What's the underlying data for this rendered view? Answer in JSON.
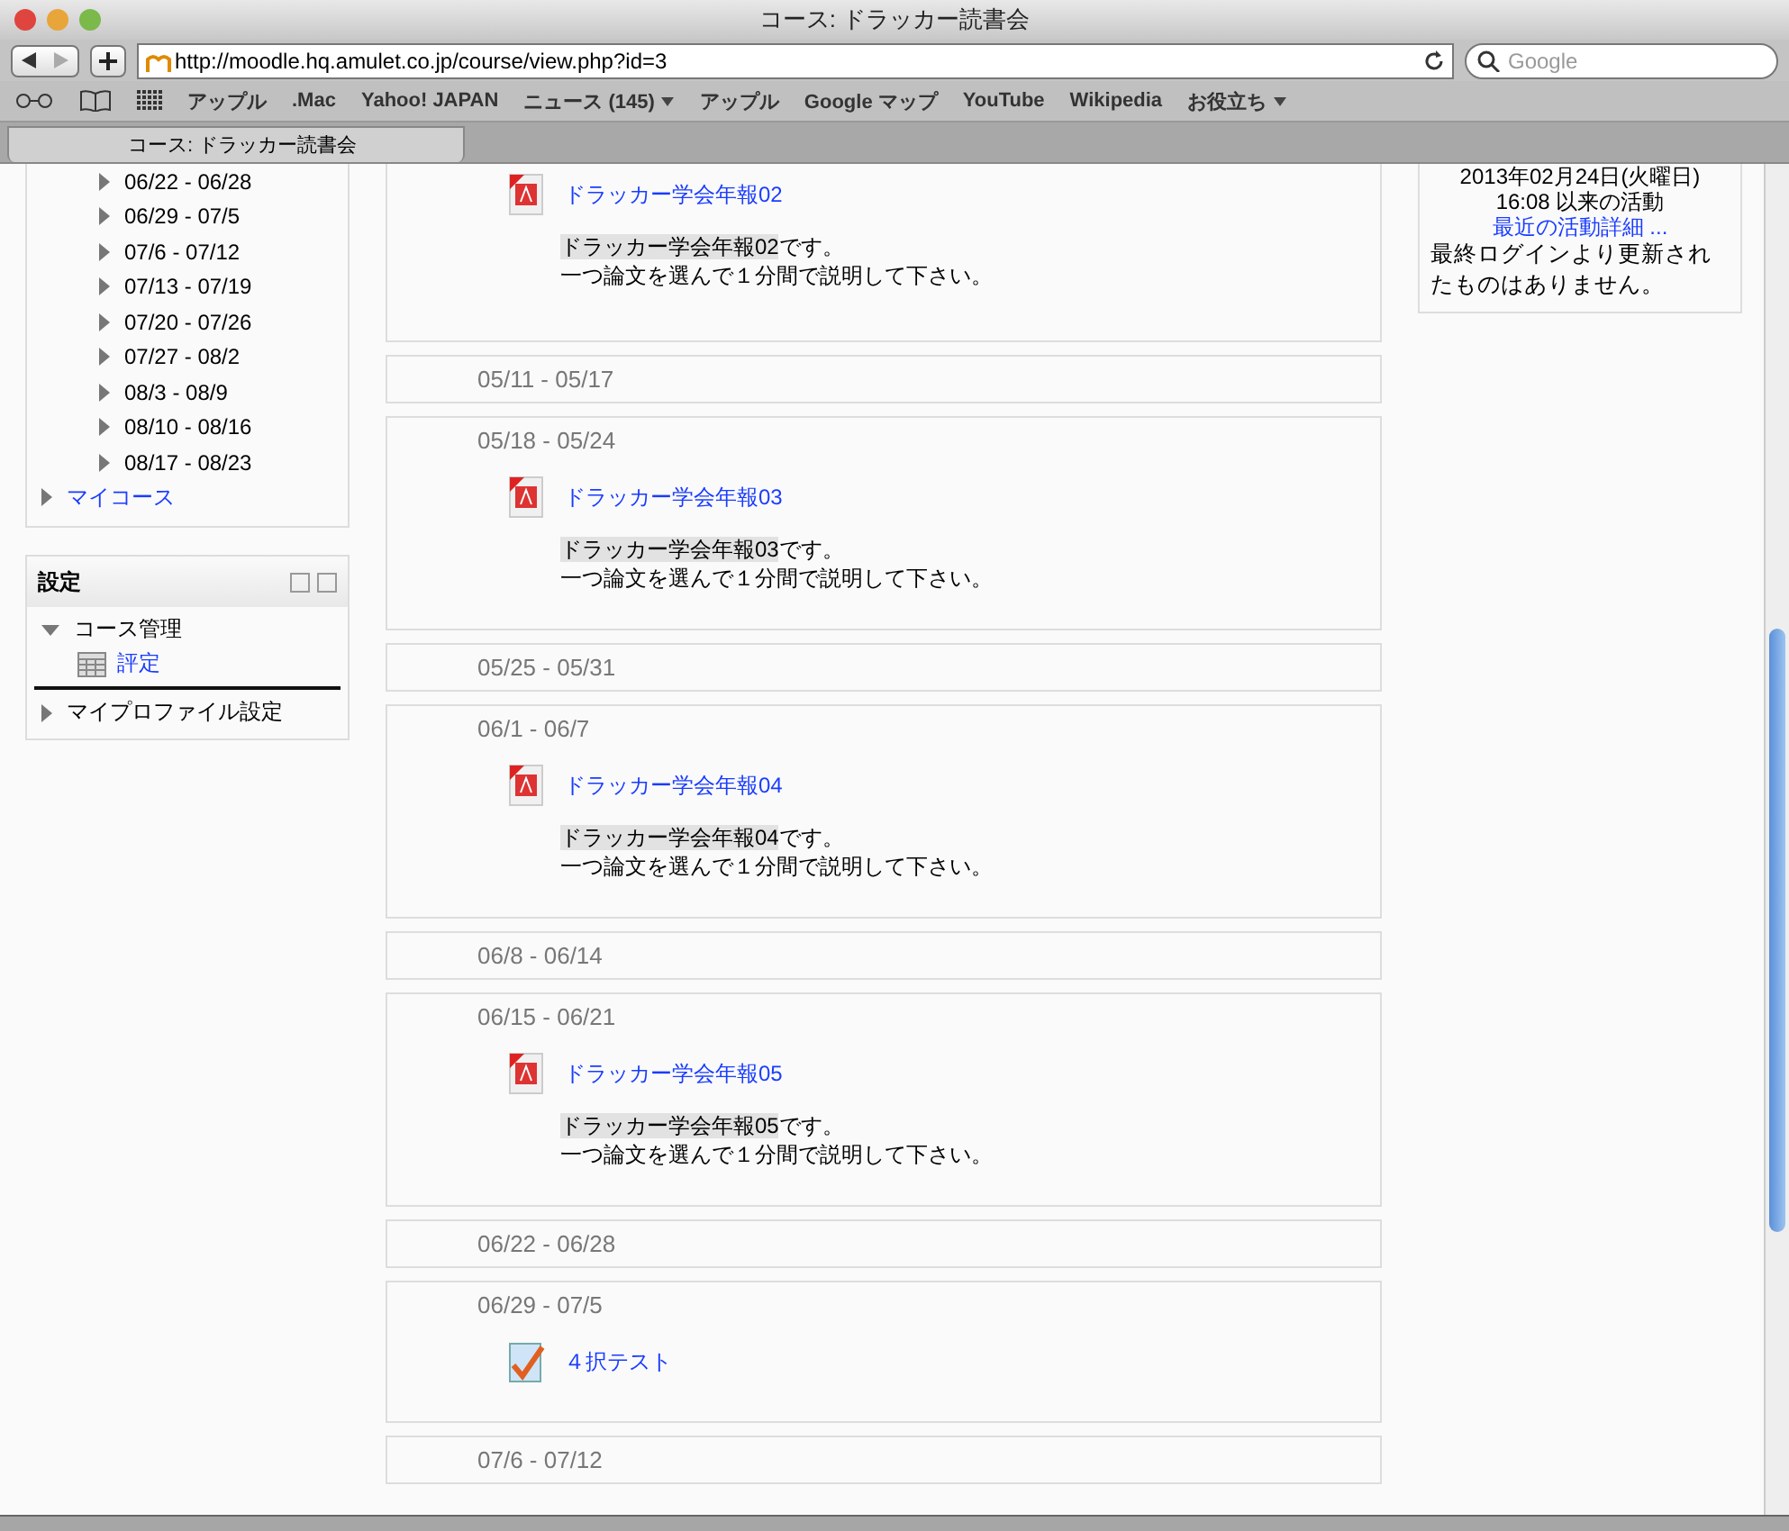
{
  "window": {
    "title": "コース: ドラッカー読書会"
  },
  "toolbar": {
    "url": "http://moodle.hq.amulet.co.jp/course/view.php?id=3",
    "search": {
      "placeholder": "Google"
    }
  },
  "bookmarks": [
    {
      "label": "アップル",
      "menu": false
    },
    {
      "label": ".Mac",
      "menu": false
    },
    {
      "label": "Yahoo! JAPAN",
      "menu": false
    },
    {
      "label": "ニュース (145)",
      "menu": true
    },
    {
      "label": "アップル",
      "menu": false
    },
    {
      "label": "Google マップ",
      "menu": false
    },
    {
      "label": "YouTube",
      "menu": false
    },
    {
      "label": "Wikipedia",
      "menu": false
    },
    {
      "label": "お役立ち",
      "menu": true
    }
  ],
  "tabs": [
    {
      "label": "コース: ドラッカー読書会",
      "selected": true
    }
  ],
  "navigation": {
    "weeks": [
      "06/22 - 06/28",
      "06/29 - 07/5",
      "07/6 - 07/12",
      "07/13 - 07/19",
      "07/20 - 07/26",
      "07/27 - 08/2",
      "08/3 - 08/9",
      "08/10 - 08/16",
      "08/17 - 08/23"
    ],
    "my_courses": "マイコース"
  },
  "settings": {
    "title": "設定",
    "items": [
      {
        "label": "コース管理",
        "expanded": true,
        "children": [
          {
            "label": "評定"
          }
        ]
      },
      {
        "label": "マイプロファイル設定",
        "expanded": false
      }
    ]
  },
  "sections": [
    {
      "activities": [
        {
          "kind": "pdf",
          "link": "ドラッカー学会年報02",
          "highlight": "ドラッカー学会年報02",
          "rest": "です。",
          "note": "一つ論文を選んで１分間で説明して下さい。"
        }
      ]
    },
    {
      "title": "05/11 - 05/17"
    },
    {
      "title": "05/18 - 05/24",
      "activities": [
        {
          "kind": "pdf",
          "link": "ドラッカー学会年報03",
          "highlight": "ドラッカー学会年報03",
          "rest": "です。",
          "note": "一つ論文を選んで１分間で説明して下さい。"
        }
      ]
    },
    {
      "title": "05/25 - 05/31"
    },
    {
      "title": "06/1 - 06/7",
      "activities": [
        {
          "kind": "pdf",
          "link": "ドラッカー学会年報04",
          "highlight": "ドラッカー学会年報04",
          "rest": "です。",
          "note": "一つ論文を選んで１分間で説明して下さい。"
        }
      ]
    },
    {
      "title": "06/8 - 06/14"
    },
    {
      "title": "06/15 - 06/21",
      "activities": [
        {
          "kind": "pdf",
          "link": "ドラッカー学会年報05",
          "highlight": "ドラッカー学会年報05",
          "rest": "です。",
          "note": "一つ論文を選んで１分間で説明して下さい。"
        }
      ]
    },
    {
      "title": "06/22 - 06/28"
    },
    {
      "title": "06/29 - 07/5",
      "activities": [
        {
          "kind": "quiz",
          "link": "４択テスト"
        }
      ]
    },
    {
      "title": "07/6 - 07/12"
    }
  ],
  "recent": {
    "date": "2013年02月24日(火曜日)",
    "since": "16:08 以来の活動",
    "link": "最近の活動詳細 ...",
    "message": "最終ログインより更新されたものはありません。"
  }
}
